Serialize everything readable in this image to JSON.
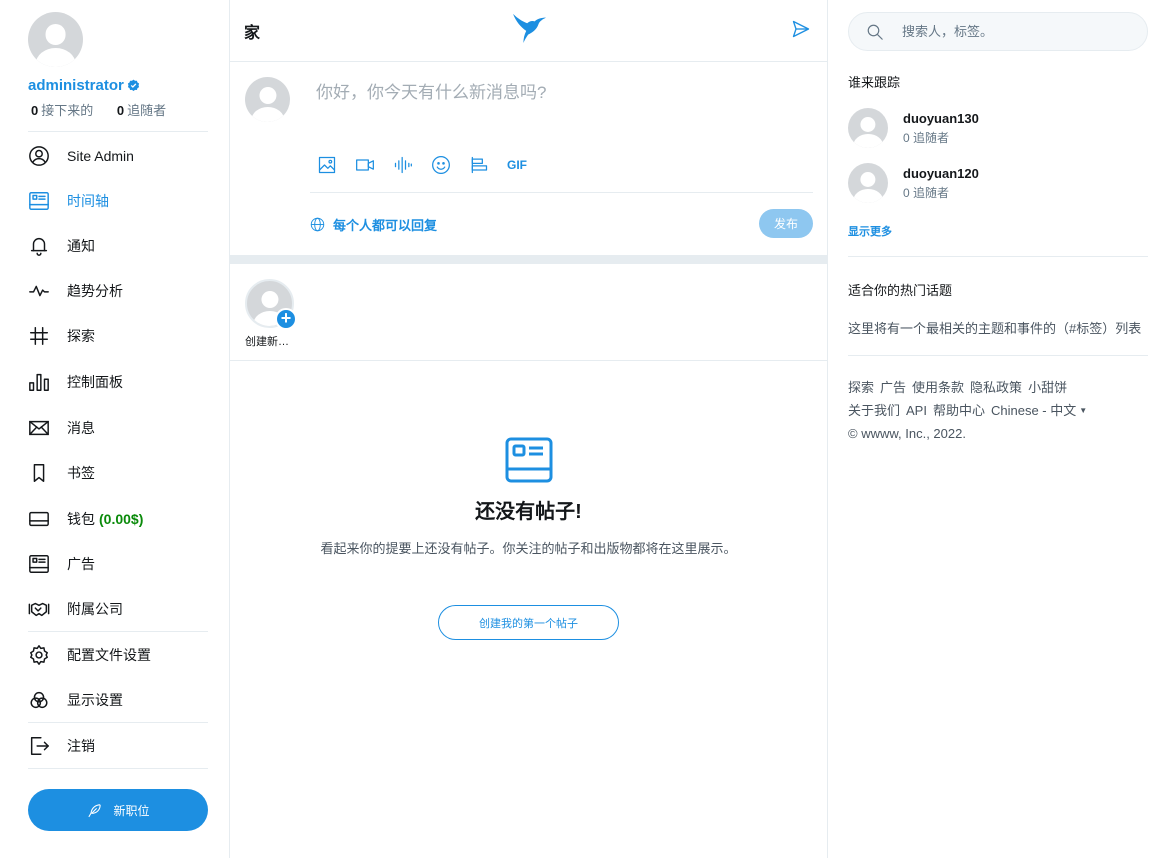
{
  "profile": {
    "username": "administrator",
    "following_count": "0",
    "following_label": "接下来的",
    "followers_count": "0",
    "followers_label": "追随者"
  },
  "nav": {
    "items": [
      {
        "label": "Site Admin",
        "icon": "user-circle-icon"
      },
      {
        "label": "时间轴",
        "icon": "timeline-icon",
        "active": true
      },
      {
        "label": "通知",
        "icon": "bell-icon"
      },
      {
        "label": "趋势分析",
        "icon": "pulse-icon"
      },
      {
        "label": "探索",
        "icon": "hashtag-icon"
      },
      {
        "label": "控制面板",
        "icon": "bar-chart-icon"
      },
      {
        "label": "消息",
        "icon": "envelope-icon"
      },
      {
        "label": "书签",
        "icon": "bookmark-icon"
      },
      {
        "label": "钱包",
        "icon": "wallet-icon",
        "badge": "(0.00$)"
      },
      {
        "label": "广告",
        "icon": "ads-icon"
      },
      {
        "label": "附属公司",
        "icon": "handshake-icon"
      },
      {
        "label": "配置文件设置",
        "icon": "gear-icon"
      },
      {
        "label": "显示设置",
        "icon": "display-icon"
      },
      {
        "label": "注销",
        "icon": "logout-icon"
      }
    ],
    "new_post_label": "新职位"
  },
  "header": {
    "title": "家"
  },
  "composer": {
    "placeholder": "你好，你今天有什么新消息吗?",
    "gif_label": "GIF",
    "reply_setting": "每个人都可以回复",
    "publish_label": "发布"
  },
  "stories": {
    "create_label": "创建新…"
  },
  "empty_state": {
    "title": "还没有帖子!",
    "description": "看起来你的提要上还没有帖子。你关注的帖子和出版物都将在这里展示。",
    "button_label": "创建我的第一个帖子"
  },
  "right": {
    "search_placeholder": "搜索人，标签。",
    "who_to_follow_heading": "谁来跟踪",
    "suggestions": [
      {
        "name": "duoyuan130",
        "meta": "0 追随者"
      },
      {
        "name": "duoyuan120",
        "meta": "0 追随者"
      }
    ],
    "show_more": "显示更多",
    "trends_heading": "适合你的热门话题",
    "trends_text": "这里将有一个最相关的主题和事件的（#标签）列表",
    "footer_links": [
      "探索",
      "广告",
      "使用条款",
      "隐私政策",
      "小甜饼",
      "关于我们",
      "API",
      "帮助中心",
      "Chinese - 中文"
    ],
    "copyright": "© wwww, Inc., 2022."
  },
  "colors": {
    "accent": "#1d8fe1",
    "wallet_balance": "#0a8a0a",
    "publish_disabled": "#8ec7f0"
  }
}
